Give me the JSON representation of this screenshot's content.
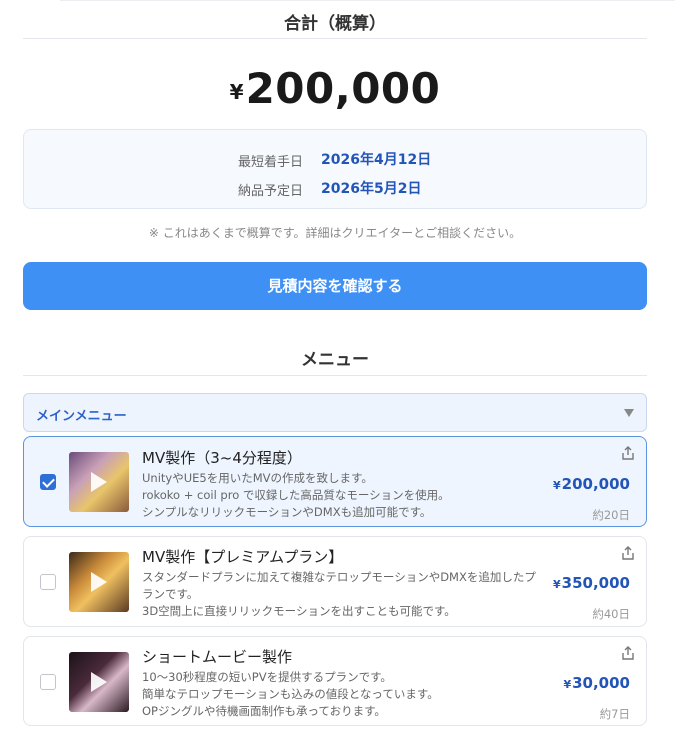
{
  "summary": {
    "title": "合計（概算）",
    "currency": "¥",
    "total": "200,000",
    "earliest_start_label": "最短着手日",
    "earliest_start_value": "2026年4月12日",
    "delivery_label": "納品予定日",
    "delivery_value": "2026年5月2日",
    "note": "※ これはあくまで概算です。詳細はクリエイターとご相談ください。",
    "confirm_label": "見積内容を確認する"
  },
  "menu": {
    "title": "メニュー",
    "dropdown_label": "メインメニュー",
    "items": [
      {
        "title": "MV製作（3~4分程度）",
        "desc": [
          "UnityやUE5を用いたMVの作成を致します。",
          "rokoko + coil pro で収録した高品質なモーションを使用。",
          "シンプルなリリックモーションやDMXも追加可能です。"
        ],
        "currency": "¥",
        "price": "200,000",
        "days": "約20日",
        "checked": true
      },
      {
        "title": "MV製作【プレミアムプラン】",
        "desc": [
          "スタンダードプランに加えて複雑なテロップモーションやDMXを追加したプ",
          "ランです。",
          "3D空間上に直接リリックモーションを出すことも可能です。"
        ],
        "currency": "¥",
        "price": "350,000",
        "days": "約40日",
        "checked": false
      },
      {
        "title": "ショートムービー製作",
        "desc": [
          "10〜30秒程度の短いPVを提供するプランです。",
          "簡単なテロップモーションも込みの値段となっています。",
          "OPジングルや待機画面制作も承っております。"
        ],
        "currency": "¥",
        "price": "30,000",
        "days": "約7日",
        "checked": false
      }
    ]
  },
  "colors": {
    "accent": "#3e90f5",
    "price": "#2355b8",
    "selected_bg": "#eef5ff"
  },
  "icons": [
    "check-icon",
    "play-icon",
    "share-icon",
    "chevron-down-icon"
  ]
}
